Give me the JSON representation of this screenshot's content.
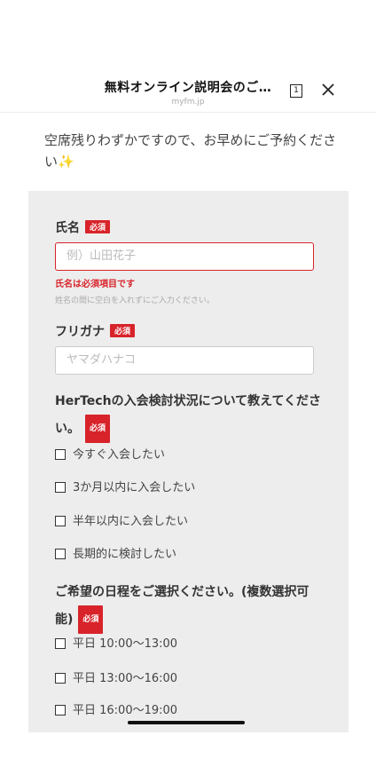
{
  "header": {
    "title": "無料オンライン説明会のご…",
    "url": "myfm.jp",
    "tab_count": "1"
  },
  "intro": {
    "text": "空席残りわずかですので、お早めにご予約ください",
    "emoji": "✨"
  },
  "form": {
    "required_badge": "必須",
    "name": {
      "label": "氏名",
      "placeholder": "例）山田花子",
      "error": "氏名は必須項目です",
      "hint": "姓名の間に空白を入れずにご入力ください。"
    },
    "kana": {
      "label": "フリガナ",
      "placeholder": "ヤマダハナコ"
    },
    "status": {
      "question": "HerTechの入会検討状況について教えてください。",
      "options": [
        "今すぐ入会したい",
        "3か月以内に入会したい",
        "半年以内に入会したい",
        "長期的に検討したい"
      ]
    },
    "schedule": {
      "question": "ご希望の日程をご選択ください。(複数選択可能)",
      "options": [
        "平日 10:00〜13:00",
        "平日 13:00〜16:00",
        "平日 16:00〜19:00"
      ]
    }
  },
  "colors": {
    "accent_red": "#d8232a",
    "panel_bg": "#ededed"
  }
}
